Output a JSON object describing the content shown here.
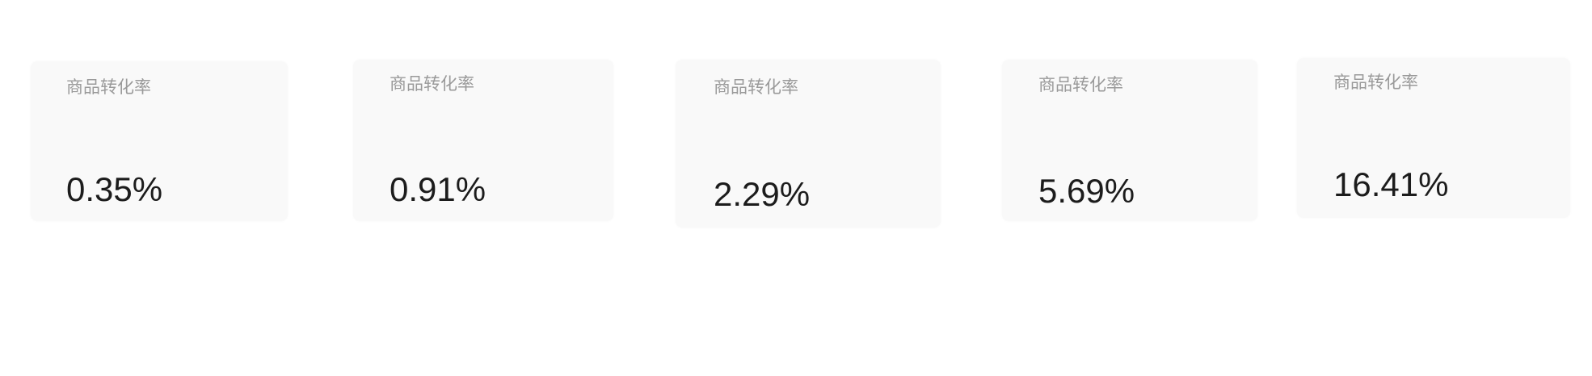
{
  "metrics": [
    {
      "label": "商品转化率",
      "value": "0.35%"
    },
    {
      "label": "商品转化率",
      "value": "0.91%"
    },
    {
      "label": "商品转化率",
      "value": "2.29%"
    },
    {
      "label": "商品转化率",
      "value": "5.69%"
    },
    {
      "label": "商品转化率",
      "value": "16.41%"
    }
  ]
}
